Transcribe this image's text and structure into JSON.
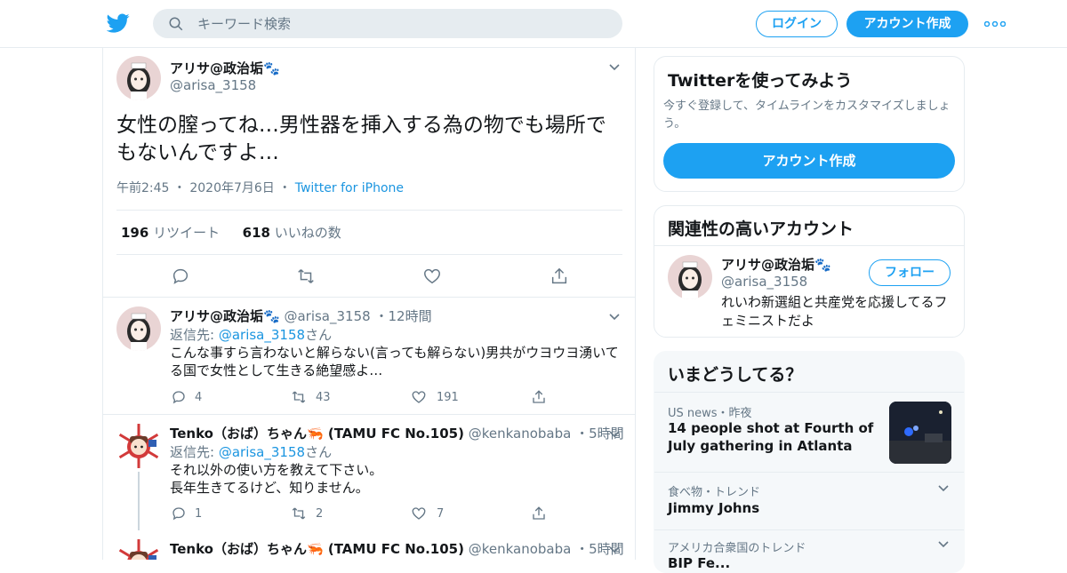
{
  "header": {
    "search_placeholder": "キーワード検索",
    "login_label": "ログイン",
    "signup_label": "アカウント作成"
  },
  "main_tweet": {
    "name": "アリサ@政治垢🐾",
    "handle": "@arisa_3158",
    "text": "女性の膣ってね…男性器を挿入する為の物でも場所でもないんですよ…",
    "time": "午前2:45",
    "date": "2020年7月6日",
    "source": "Twitter for iPhone",
    "retweets": "196",
    "retweets_label": "リツイート",
    "likes": "618",
    "likes_label": "いいねの数"
  },
  "replies": [
    {
      "name": "アリサ@政治垢🐾",
      "handle": "@arisa_3158",
      "time": "12時間",
      "replyto_label": "返信先:",
      "replyto_handle": "@arisa_3158",
      "replyto_suffix": "さん",
      "text": "こんな事すら言わないと解らない(言っても解らない)男共がウヨウヨ湧いてる国で女性として生きる絶望感よ…",
      "replies": "4",
      "retweets": "43",
      "likes": "191"
    },
    {
      "name": "Tenko（おば）ちゃん🦐 (TAMU FC No.105)",
      "handle": "@kenkanobaba",
      "time": "5時間",
      "replyto_label": "返信先:",
      "replyto_handle": "@arisa_3158",
      "replyto_suffix": "さん",
      "text_line1": "それ以外の使い方を教えて下さい。",
      "text_line2": "長年生きてるけど、知りません。",
      "replies": "1",
      "retweets": "2",
      "likes": "7"
    },
    {
      "name": "Tenko（おば）ちゃん🦐 (TAMU FC No.105)",
      "handle": "@kenkanobaba",
      "time": "5時間"
    }
  ],
  "sidebar": {
    "try_title": "Twitterを使ってみよう",
    "try_sub": "今すぐ登録して、タイムラインをカスタマイズしましょう。",
    "try_cta": "アカウント作成",
    "related_title": "関連性の高いアカウント",
    "related_name": "アリサ@政治垢🐾",
    "related_handle": "@arisa_3158",
    "follow_label": "フォロー",
    "related_bio": "れいわ新選組と共産党を応援してるフェミニストだよ",
    "trends_title": "いまどうしてる？",
    "trends": [
      {
        "category": "US news・昨夜",
        "topic": "14 people shot at Fourth of July gathering in Atlanta"
      },
      {
        "category": "食べ物・トレンド",
        "topic": "Jimmy Johns"
      },
      {
        "category": "アメリカ合衆国のトレンド",
        "topic": "BIP Fe..."
      }
    ]
  },
  "colors": {
    "accent": "#1da1f2",
    "link": "#1b95e0",
    "muted": "#657786",
    "border": "#e6ecf0"
  }
}
